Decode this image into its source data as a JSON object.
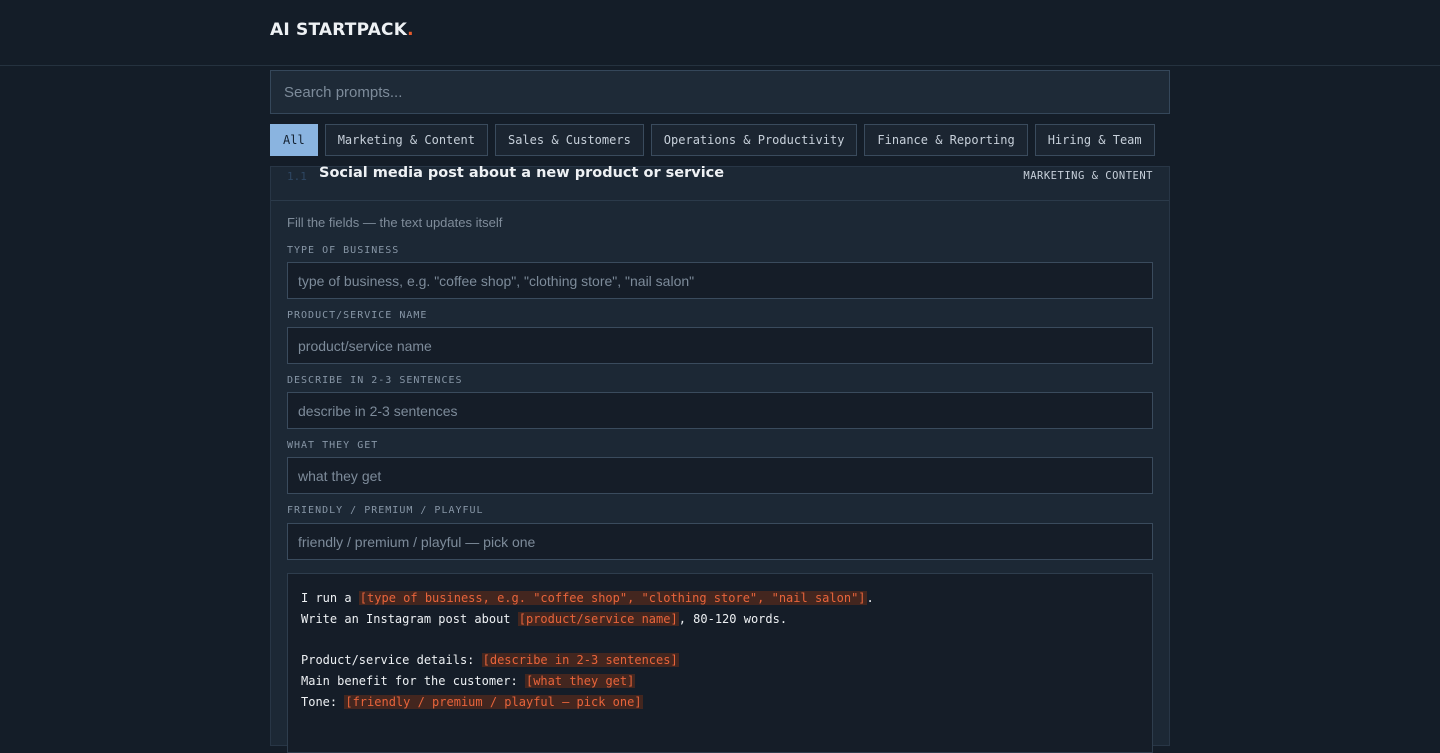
{
  "header": {
    "logo_text": "AI STARTPACK",
    "logo_dot": "."
  },
  "search": {
    "placeholder": "Search prompts...",
    "value": ""
  },
  "filters": [
    {
      "label": "All",
      "active": true
    },
    {
      "label": "Marketing & Content",
      "active": false
    },
    {
      "label": "Sales & Customers",
      "active": false
    },
    {
      "label": "Operations & Productivity",
      "active": false
    },
    {
      "label": "Finance & Reporting",
      "active": false
    },
    {
      "label": "Hiring & Team",
      "active": false
    }
  ],
  "card": {
    "number": "1.1",
    "title": "Social media post about a new product or service",
    "category": "MARKETING & CONTENT",
    "hint": "Fill the fields — the text updates itself",
    "fields": [
      {
        "label": "TYPE OF BUSINESS",
        "placeholder": "type of business, e.g. \"coffee shop\", \"clothing store\", \"nail salon\"",
        "value": ""
      },
      {
        "label": "PRODUCT/SERVICE NAME",
        "placeholder": "product/service name",
        "value": ""
      },
      {
        "label": "DESCRIBE IN 2-3 SENTENCES",
        "placeholder": "describe in 2-3 sentences",
        "value": ""
      },
      {
        "label": "WHAT THEY GET",
        "placeholder": "what they get",
        "value": ""
      },
      {
        "label": "FRIENDLY / PREMIUM / PLAYFUL",
        "placeholder": "friendly / premium / playful — pick one",
        "value": ""
      }
    ],
    "preview": {
      "line1_a": "I run a ",
      "line1_ph": "[type of business, e.g. \"coffee shop\", \"clothing store\", \"nail salon\"]",
      "line1_b": ".",
      "line2_a": "Write an Instagram post about ",
      "line2_ph": "[product/service name]",
      "line2_b": ", 80-120 words.",
      "line4_a": "Product/service details: ",
      "line4_ph": "[describe in 2-3 sentences]",
      "line5_a": "Main benefit for the customer: ",
      "line5_ph": "[what they get]",
      "line6_a": "Tone: ",
      "line6_ph": "[friendly / premium / playful — pick one]"
    }
  },
  "colors": {
    "background": "#141d28",
    "accent_chip": "#8ab4e0",
    "placeholder_highlight": "#e8643b",
    "logo_dot": "#e25a2c"
  }
}
